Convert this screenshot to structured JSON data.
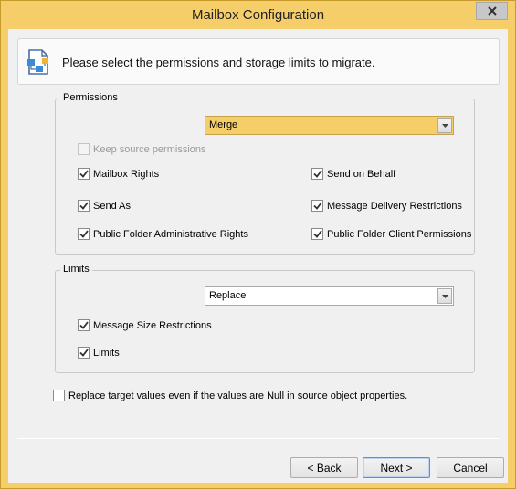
{
  "window": {
    "title": "Mailbox Configuration",
    "close_icon": "close-icon"
  },
  "banner": {
    "icon": "document-sitemap-icon",
    "text": "Please select the permissions and storage limits to migrate."
  },
  "permissions": {
    "legend": "Permissions",
    "mode": "Merge",
    "keep_source": {
      "label": "Keep source permissions",
      "checked": false,
      "disabled": true
    },
    "items": [
      {
        "label": "Mailbox Rights",
        "checked": true
      },
      {
        "label": "Send on Behalf",
        "checked": true
      },
      {
        "label": "Send As",
        "checked": true
      },
      {
        "label": "Message Delivery Restrictions",
        "checked": true
      },
      {
        "label": "Public Folder Administrative Rights",
        "checked": true
      },
      {
        "label": "Public Folder Client Permissions",
        "checked": true
      }
    ]
  },
  "limits": {
    "legend": "Limits",
    "mode": "Replace",
    "items": [
      {
        "label": "Message Size Restrictions",
        "checked": true
      },
      {
        "label": "Limits",
        "checked": true
      }
    ]
  },
  "replace_null": {
    "label": "Replace target values even if the values are Null in source object properties.",
    "checked": false
  },
  "buttons": {
    "back": {
      "prefix": "< ",
      "mnemonic": "B",
      "rest": "ack"
    },
    "next": {
      "mnemonic": "N",
      "rest": "ext >"
    },
    "cancel": "Cancel"
  },
  "colors": {
    "title_bar": "#f5ce6a",
    "dialog_bg": "#f0f0f0",
    "merge_combo": "#f5ce6a"
  }
}
